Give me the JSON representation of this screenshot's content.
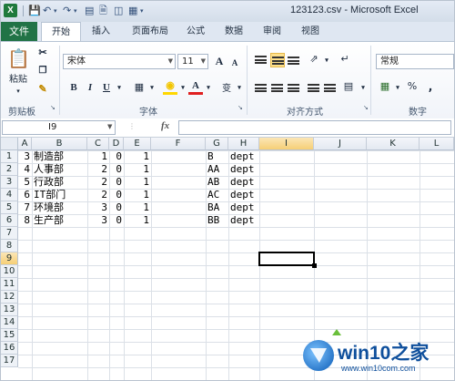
{
  "window": {
    "title": "123123.csv - Microsoft Excel"
  },
  "quick_access": {
    "save_icon": "save-icon",
    "undo_icon": "undo-icon",
    "redo_icon": "redo-icon"
  },
  "ribbon_tabs": [
    "文件",
    "开始",
    "插入",
    "页面布局",
    "公式",
    "数据",
    "审阅",
    "视图"
  ],
  "ribbon": {
    "clipboard": {
      "paste_label": "粘贴",
      "group_label": "剪贴板"
    },
    "font": {
      "name": "宋体",
      "size": "11",
      "group_label": "字体",
      "bold": "B",
      "italic": "I",
      "underline": "U",
      "grow": "A",
      "shrink": "A",
      "color_a": "A",
      "wen": "变"
    },
    "alignment": {
      "group_label": "对齐方式"
    },
    "number": {
      "format": "常规",
      "group_label": "数字",
      "percent": "%",
      "comma": ","
    }
  },
  "formula_bar": {
    "name_box": "I9",
    "fx": "fx",
    "value": ""
  },
  "sheet": {
    "columns": [
      "A",
      "B",
      "C",
      "D",
      "E",
      "F",
      "G",
      "H",
      "I",
      "J",
      "K",
      "L"
    ],
    "rows": [
      "1",
      "2",
      "3",
      "4",
      "5",
      "6",
      "7",
      "8",
      "9",
      "10",
      "11",
      "12",
      "13",
      "14",
      "15",
      "16",
      "17"
    ],
    "data": [
      [
        "3",
        "制造部",
        "1",
        "0",
        "1",
        "",
        "B",
        "dept"
      ],
      [
        "4",
        "人事部",
        "2",
        "0",
        "1",
        "",
        "AA",
        "dept"
      ],
      [
        "5",
        "行政部",
        "2",
        "0",
        "1",
        "",
        "AB",
        "dept"
      ],
      [
        "6",
        "IT部门",
        "2",
        "0",
        "1",
        "",
        "AC",
        "dept"
      ],
      [
        "7",
        "环境部",
        "3",
        "0",
        "1",
        "",
        "BA",
        "dept"
      ],
      [
        "8",
        "生产部",
        "3",
        "0",
        "1",
        "",
        "BB",
        "dept"
      ]
    ],
    "active_cell": "I9"
  },
  "watermark": {
    "brand": "win10之家",
    "url": "www.win10com.com"
  }
}
